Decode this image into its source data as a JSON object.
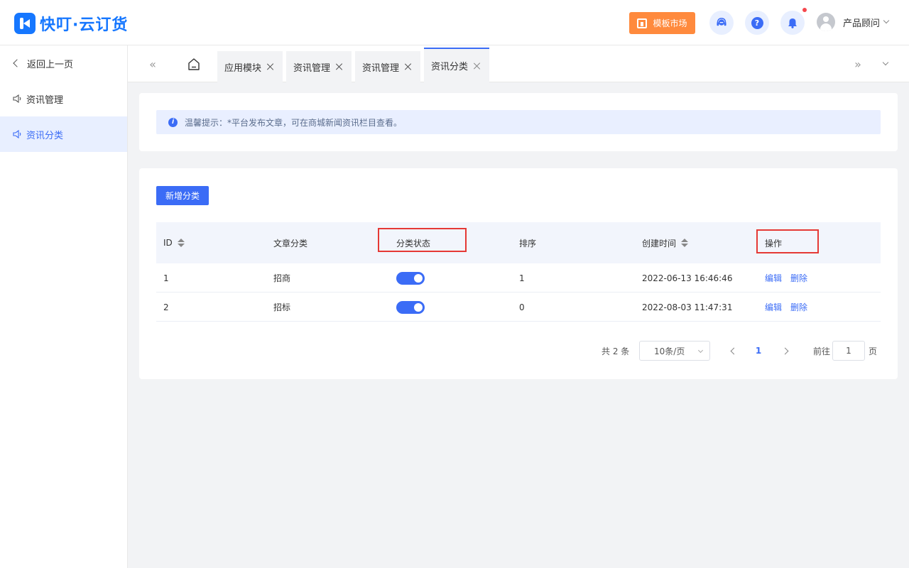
{
  "header": {
    "brand": "快叮·云订货",
    "template_market": "模板市场",
    "user_name": "产品顾问"
  },
  "sidebar": {
    "back": "返回上一页",
    "items": [
      {
        "label": "资讯管理",
        "active": false
      },
      {
        "label": "资讯分类",
        "active": true
      }
    ]
  },
  "tabs": [
    {
      "label": "应用模块"
    },
    {
      "label": "资讯管理"
    },
    {
      "label": "资讯管理"
    },
    {
      "label": "资讯分类",
      "active": true
    }
  ],
  "notice": {
    "text": "温馨提示：*平台发布文章，可在商城新闻资讯栏目查看。"
  },
  "toolbar": {
    "add_label": "新增分类"
  },
  "table": {
    "columns": [
      "ID",
      "文章分类",
      "分类状态",
      "排序",
      "创建时间",
      "操作"
    ],
    "rows": [
      {
        "id": "1",
        "category": "招商",
        "enabled": true,
        "sort": "1",
        "created": "2022-06-13 16:46:46",
        "edit": "编辑",
        "delete": "删除"
      },
      {
        "id": "2",
        "category": "招标",
        "enabled": true,
        "sort": "0",
        "created": "2022-08-03 11:47:31",
        "edit": "编辑",
        "delete": "删除"
      }
    ]
  },
  "pagination": {
    "total": "共 2 条",
    "page_size": "10条/页",
    "current_page": "1",
    "goto_prefix": "前往",
    "goto_value": "1",
    "goto_suffix": "页"
  },
  "colors": {
    "accent": "#3b6cf6",
    "orange": "#ff8a3d",
    "highlight_box": "#e53935"
  }
}
